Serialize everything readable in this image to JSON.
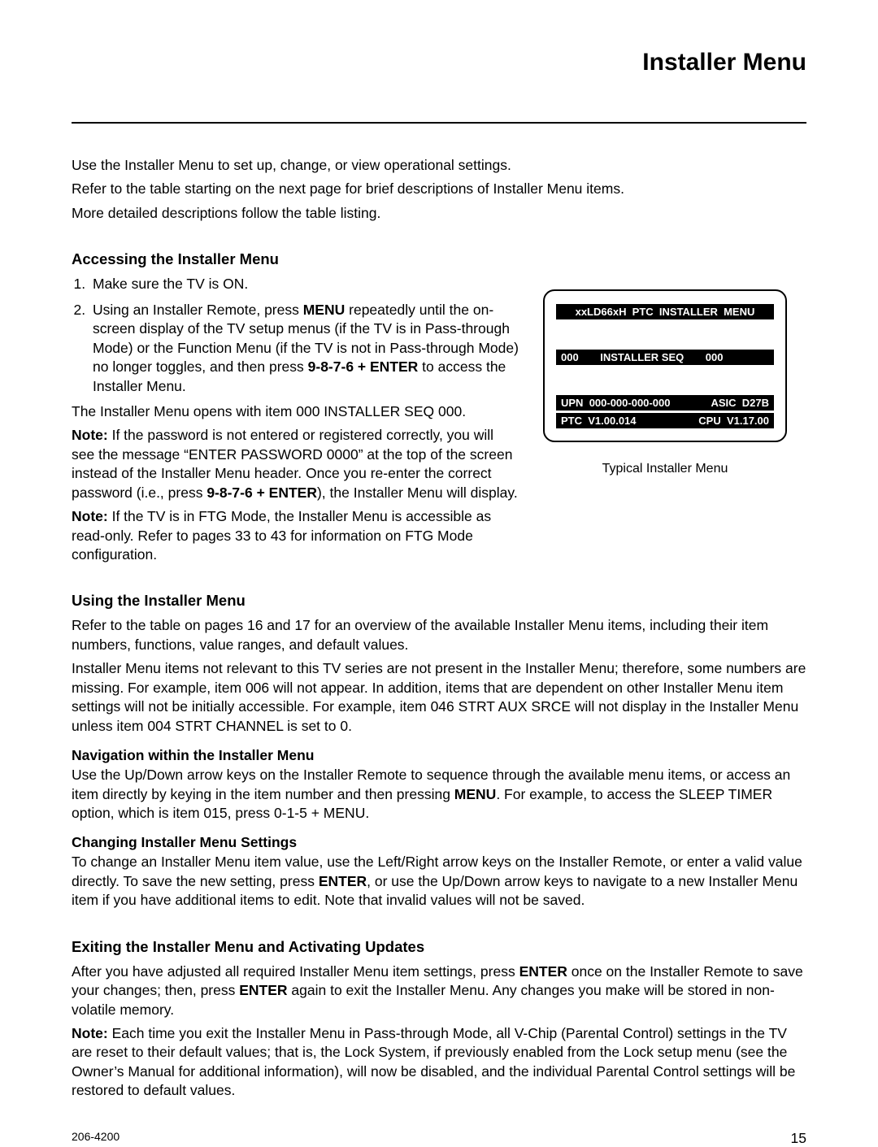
{
  "page_title": "Installer Menu",
  "intro": {
    "l1": "Use the Installer Menu to set up, change, or view operational settings.",
    "l2": "Refer to the table starting on the next page for brief descriptions of Installer Menu items.",
    "l3": "More detailed descriptions follow the table listing."
  },
  "accessing": {
    "heading": "Accessing the Installer Menu",
    "step1": "Make sure the TV is ON.",
    "step2_a": "Using an Installer Remote, press ",
    "step2_menu": "MENU",
    "step2_b": " repeatedly until the on-screen display of the TV setup menus (if the TV is in Pass-through Mode) or the Function Menu (if the TV is not in Pass-through Mode) no longer toggles, and then press ",
    "step2_code": "9-8-7-6 + ENTER",
    "step2_c": " to access the Installer Menu.",
    "p_opens": "The Installer Menu opens with item 000 INSTALLER SEQ 000.",
    "note1_lead": "Note: ",
    "note1_a": "If the password is not entered or registered correctly, you will see the message “ENTER PASSWORD 0000” at the top of the screen instead of the Installer Menu header. Once you re-enter the correct password (i.e., press ",
    "note1_code": "9-8-7-6 + ENTER",
    "note1_b": "), the Installer Menu will display.",
    "note2_lead": "Note: ",
    "note2_body": "If the TV is in FTG Mode, the Installer Menu is accessible as read-only. Refer to pages 33 to 43 for information on FTG Mode configuration."
  },
  "menu_box": {
    "row1": "xxLD66xH  PTC  INSTALLER  MENU",
    "row2_a": "000",
    "row2_b": "INSTALLER SEQ",
    "row2_c": "000",
    "row3_a": "UPN",
    "row3_b": "000-000-000-000",
    "row3_c": "ASIC",
    "row3_d": "D27B",
    "row4_a": "PTC",
    "row4_b": "V1.00.014",
    "row4_c": "CPU",
    "row4_d": "V1.17.00",
    "caption": "Typical Installer Menu"
  },
  "using": {
    "heading": "Using the Installer Menu",
    "p1": "Refer to the table on pages 16 and 17 for an overview of the available Installer Menu items, including their item numbers, functions, value ranges, and default values.",
    "p2": "Installer Menu items not relevant to this TV series are not present in the Installer Menu; therefore, some numbers are missing. For example, item 006 will not appear. In addition, items that are dependent on other Installer Menu item settings will not be initially accessible. For example, item 046 STRT AUX SRCE will not display in the Installer Menu unless item 004 STRT CHANNEL is set to 0.",
    "nav_head": "Navigation within the Installer Menu",
    "nav_a": "Use the Up/Down arrow keys on the Installer Remote to sequence through the available menu items, or access an item directly by keying in the item number and then pressing ",
    "nav_menu": "MENU",
    "nav_b": ". For example, to access the SLEEP TIMER option, which is item 015, press 0-1-5 + MENU.",
    "chg_head": "Changing Installer Menu Settings",
    "chg_a": "To change an Installer Menu item value, use the Left/Right arrow keys on the Installer Remote, or enter a valid value directly. To save the new setting, press ",
    "chg_enter": "ENTER",
    "chg_b": ", or use the Up/Down arrow keys to navigate to a new Installer Menu item if you have additional items to edit. Note that invalid values will not be saved."
  },
  "exiting": {
    "heading": "Exiting the Installer Menu and Activating Updates",
    "p1_a": "After you have adjusted all required Installer Menu item settings, press ",
    "p1_enter1": "ENTER",
    "p1_b": " once on the Installer Remote to save your changes; then, press ",
    "p1_enter2": "ENTER",
    "p1_c": " again to exit the Installer Menu. Any changes you make will be stored in non-volatile memory.",
    "note_lead": "Note: ",
    "note_body": "Each time you exit the Installer Menu in Pass-through Mode, all V-Chip (Parental Control) settings in the TV are reset to their default values; that is, the Lock System, if previously enabled from the Lock setup menu (see the Owner’s Manual for additional information), will now be disabled, and the individual Parental Control settings will be restored to default values."
  },
  "footer": {
    "docnum": "206-4200",
    "pagenum": "15"
  }
}
